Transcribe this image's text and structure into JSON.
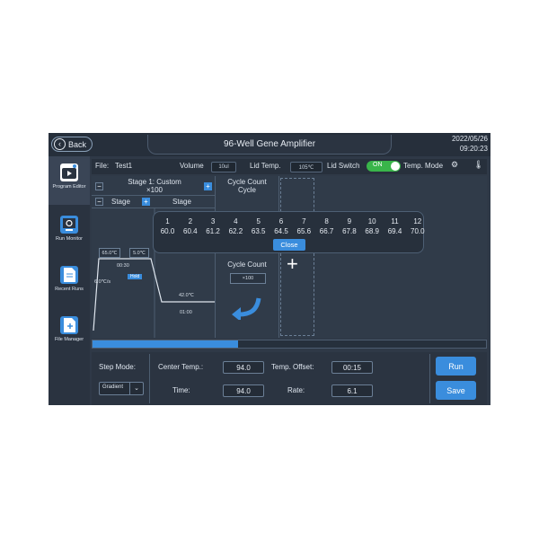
{
  "header": {
    "back_label": "Back",
    "title": "96-Well Gene Amplifier",
    "date": "2022/05/26",
    "time": "09:20:23"
  },
  "sidebar": {
    "items": [
      {
        "label": "Program Editor",
        "icon": "program-editor-icon"
      },
      {
        "label": "Run Monitor",
        "icon": "run-monitor-icon"
      },
      {
        "label": "Recent Runs",
        "icon": "recent-runs-icon"
      },
      {
        "label": "File Manager",
        "icon": "file-manager-icon"
      }
    ]
  },
  "filebar": {
    "file_label": "File:",
    "file_name": "Test1",
    "volume_label": "Volume",
    "volume_value": "10ul",
    "lid_temp_label": "Lid Temp.",
    "lid_temp_value": "105℃",
    "lid_switch_label": "Lid Switch",
    "lid_switch_state": "ON",
    "temp_mode_label": "Temp. Mode"
  },
  "program": {
    "stage1_title": "Stage 1: Custom",
    "stage1_repeat": "×100",
    "stage_label_a": "Stage",
    "stage_label_b": "Stage",
    "temp_a": "65.0℃",
    "temp_b": "5.0℃",
    "time_a": "00:30",
    "hold_tag": "Hold",
    "rate_a": "6.0℃/s",
    "temp_c": "42.0℃",
    "time_c": "01:00",
    "cycle_count_label": "Cycle Count",
    "cycle_label": "Cycle",
    "cycle_count_label_2": "Cycle Count",
    "cycle_count_value": "×100",
    "add_symbol": "+"
  },
  "progress": {
    "fraction": 0.37
  },
  "bottom": {
    "step_mode_label": "Step Mode:",
    "step_mode_value": "Gradient",
    "center_temp_label": "Center Temp.:",
    "center_temp_value": "94.0",
    "temp_offset_label": "Temp. Offset:",
    "temp_offset_value": "00:15",
    "time_label": "Time:",
    "time_value": "94.0",
    "rate_label": "Rate:",
    "rate_value": "6.1",
    "run_label": "Run",
    "save_label": "Save"
  },
  "popup": {
    "wells": [
      "1",
      "2",
      "3",
      "4",
      "5",
      "6",
      "7",
      "8",
      "9",
      "10",
      "11",
      "12"
    ],
    "temps": [
      "60.0",
      "60.4",
      "61.2",
      "62.2",
      "63.5",
      "64.5",
      "65.6",
      "66.7",
      "67.8",
      "68.9",
      "69.4",
      "70.0"
    ],
    "close_label": "Close"
  },
  "colors": {
    "accent": "#3a8ddd",
    "toggle_on": "#39b54a",
    "background": "#2f3947"
  }
}
